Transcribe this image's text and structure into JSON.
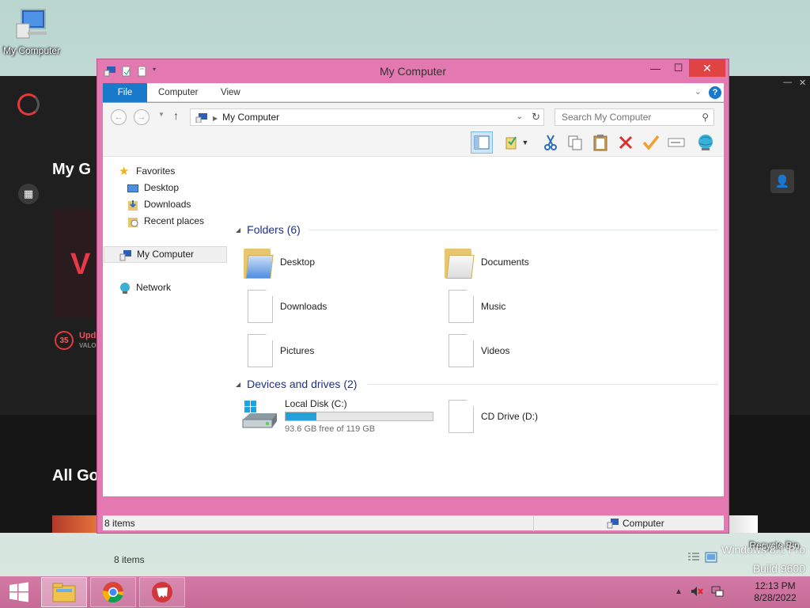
{
  "desktop": {
    "my_computer_label": "My Computer",
    "recycle_bin_label": "Recycle Bin",
    "watermark_line1": "Windows 8.1 Pro",
    "watermark_line2": "Build 9600"
  },
  "launcher": {
    "heading_top": "My G",
    "heading_bottom": "All Go",
    "update_badge": "35",
    "update_text": "Upd",
    "update_sub": "VALO"
  },
  "window": {
    "title": "My Computer",
    "tabs": [
      "File",
      "Computer",
      "View"
    ],
    "address": "My Computer",
    "search_placeholder": "Search My Computer",
    "nav": {
      "favorites": "Favorites",
      "desktop": "Desktop",
      "downloads": "Downloads",
      "recent": "Recent places",
      "computer": "My Computer",
      "network": "Network"
    },
    "folders_header": "Folders (6)",
    "folders": [
      {
        "name": "Desktop",
        "icon": "folder-icon"
      },
      {
        "name": "Documents",
        "icon": "folder-icon"
      },
      {
        "name": "Downloads",
        "icon": "file-icon"
      },
      {
        "name": "Music",
        "icon": "file-icon"
      },
      {
        "name": "Pictures",
        "icon": "file-icon"
      },
      {
        "name": "Videos",
        "icon": "file-icon"
      }
    ],
    "devices_header": "Devices and drives (2)",
    "drives": [
      {
        "name": "Local Disk (C:)",
        "free_text": "93.6 GB free of 119 GB",
        "used_fraction": 0.21
      },
      {
        "name": "CD Drive (D:)"
      }
    ],
    "items_count": "8 items",
    "status_left": "8 items",
    "status_right": "Computer"
  },
  "taskbar": {
    "time": "12:13 PM",
    "date": "8/28/2022"
  },
  "colors": {
    "window_frame": "#e478b0",
    "accent": "#1979ca",
    "close": "#e04343",
    "drive_fill": "#26a0da"
  }
}
